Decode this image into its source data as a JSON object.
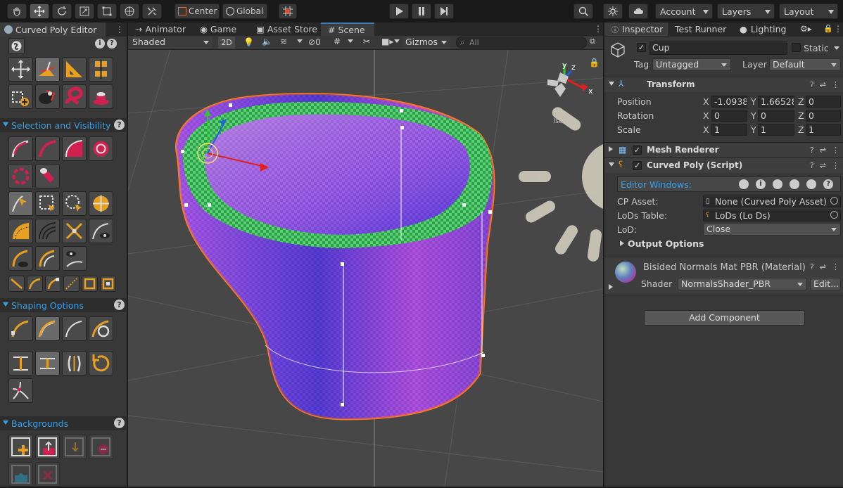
{
  "toolbar": {
    "pivot_label": "Center",
    "space_label": "Global",
    "account_label": "Account",
    "layers_label": "Layers",
    "layout_label": "Layout"
  },
  "left_panel": {
    "title": "Curved Poly Editor",
    "sections": {
      "selection": "Selection and Visibility",
      "shaping": "Shaping Options",
      "backgrounds": "Backgrounds"
    }
  },
  "scene": {
    "tabs": [
      "Animator",
      "Game",
      "Asset Store",
      "Scene"
    ],
    "draw_mode": "Shaded",
    "mode_2d": "2D",
    "hidden_count": "0",
    "gizmos_label": "Gizmos",
    "search_placeholder": "All",
    "gizmo_x": "x",
    "gizmo_y": "y",
    "gizmo_z": "z",
    "iso_label": "Iso"
  },
  "inspector": {
    "tabs": [
      "Inspector",
      "Test Runner",
      "Lighting"
    ],
    "object_name": "Cup",
    "static_label": "Static",
    "tag_label": "Tag",
    "tag_value": "Untagged",
    "layer_label": "Layer",
    "layer_value": "Default",
    "transform": {
      "title": "Transform",
      "position_label": "Position",
      "rotation_label": "Rotation",
      "scale_label": "Scale",
      "axis_x": "X",
      "axis_y": "Y",
      "axis_z": "Z",
      "position": [
        "-1.0938",
        "1.66528",
        "0"
      ],
      "rotation": [
        "0",
        "0",
        "0"
      ],
      "scale": [
        "1",
        "1",
        "1"
      ]
    },
    "mesh_renderer": "Mesh Renderer",
    "curved_poly": {
      "title": "Curved Poly (Script)",
      "editor_windows": "Editor Windows:",
      "cp_asset_label": "CP Asset:",
      "cp_asset_value": "None (Curved Poly Asset)",
      "lods_table_label": "LoDs Table:",
      "lods_table_value": "LoDs (Lo Ds)",
      "lod_label": "LoD:",
      "lod_value": "Close",
      "output_options": "Output Options"
    },
    "material": {
      "name": "Bisided Normals Mat PBR (Material)",
      "shader_label": "Shader",
      "shader_value": "NormalsShader_PBR",
      "edit_label": "Edit..."
    },
    "add_component": "Add Component"
  },
  "colors": {
    "accent_blue": "#3a79bb",
    "section_blue": "#3aa0e6",
    "selection_orange": "#ff7a1a"
  }
}
